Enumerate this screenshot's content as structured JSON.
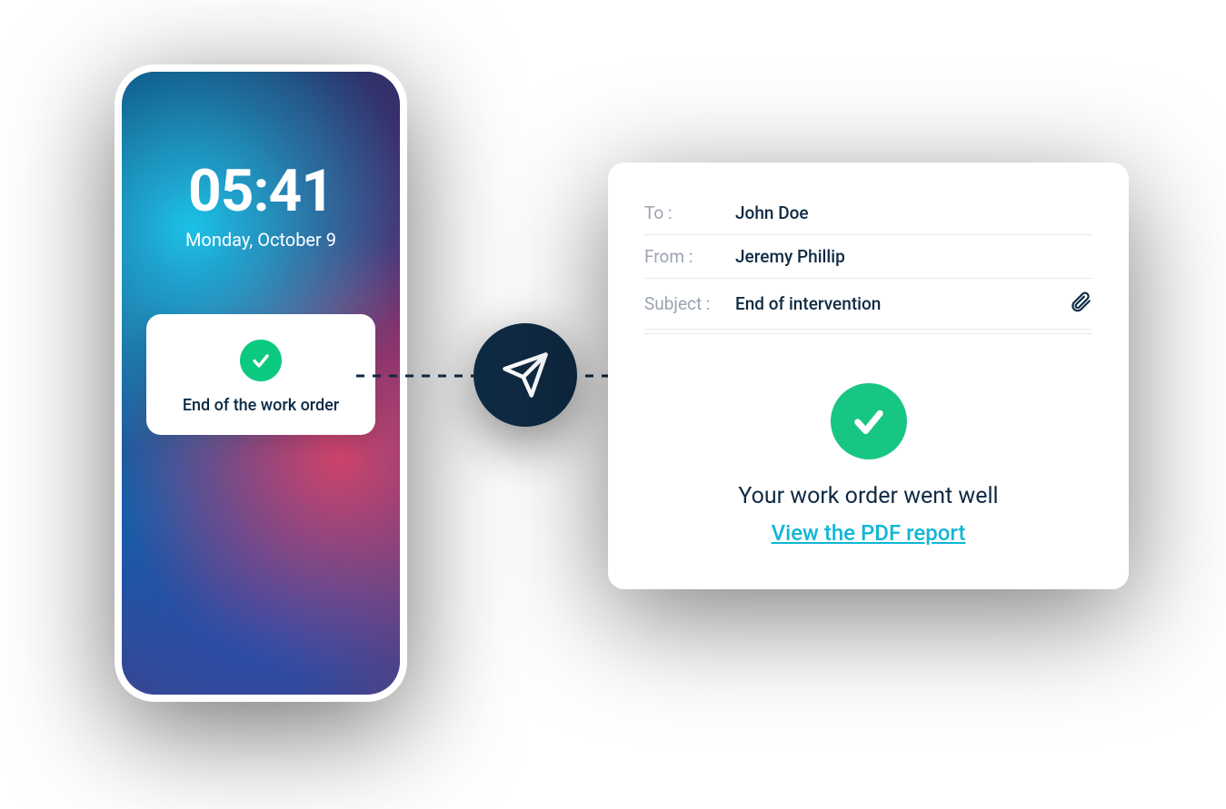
{
  "phone": {
    "time": "05:41",
    "date": "Monday, October 9",
    "notification_text": "End of the work order"
  },
  "email": {
    "to_label": "To :",
    "to_value": "John Doe",
    "from_label": "From :",
    "from_value": "Jeremy Phillip",
    "subject_label": "Subject :",
    "subject_value": "End of intervention",
    "message": "Your work order went well",
    "link_text": "View the PDF report"
  },
  "colors": {
    "navy": "#0f2a43",
    "green": "#18c683",
    "cyan": "#12b6d6",
    "label_gray": "#9aa3af"
  }
}
